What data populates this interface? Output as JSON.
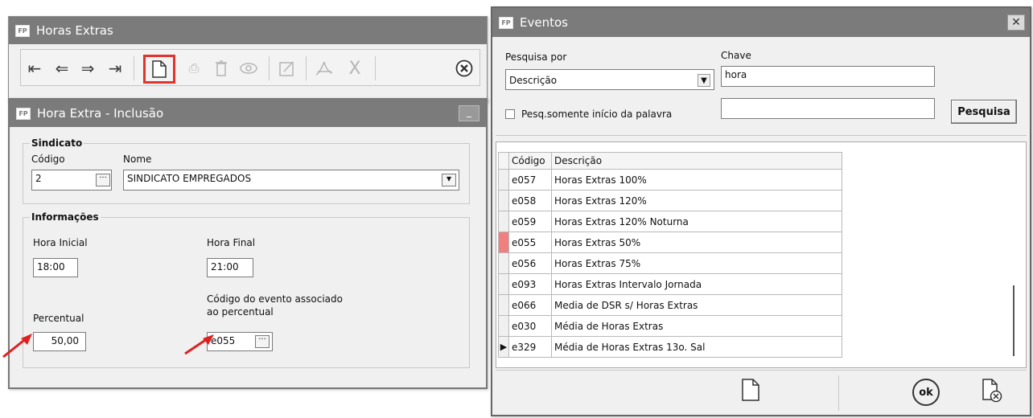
{
  "horas_extras": {
    "title": "Horas Extras",
    "toolbar": [
      "first-record",
      "previous-record",
      "next-record",
      "last-record",
      "new-document",
      "print",
      "delete",
      "view",
      "edit",
      "pdf",
      "excel",
      "close"
    ]
  },
  "inclusao": {
    "title": "Hora Extra - Inclusão",
    "sindicato": {
      "group_label": "Sindicato",
      "codigo_label": "Código",
      "codigo_value": "2",
      "nome_label": "Nome",
      "nome_value": "SINDICATO EMPREGADOS"
    },
    "informacoes": {
      "group_label": "Informações",
      "hora_inicial_label": "Hora Inicial",
      "hora_inicial_value": "18:00",
      "hora_final_label": "Hora Final",
      "hora_final_value": "21:00",
      "percentual_label": "Percentual",
      "percentual_value": "50,00",
      "codigo_evento_label_1": "Código do evento associado",
      "codigo_evento_label_2": "ao percentual",
      "codigo_evento_value": "e055"
    }
  },
  "eventos": {
    "title": "Eventos",
    "pesquisa_por_label": "Pesquisa por",
    "pesquisa_por_value": "Descrição",
    "chave_label": "Chave",
    "chave_value": "hora",
    "checkbox_label": "Pesq.somente início da palavra",
    "pesquisa_button": "Pesquisa",
    "columns": [
      "Código",
      "Descrição"
    ],
    "rows": [
      {
        "codigo": "e057",
        "descricao": "Horas Extras 100%"
      },
      {
        "codigo": "e058",
        "descricao": "Horas Extras 120%"
      },
      {
        "codigo": "e059",
        "descricao": "Horas Extras 120% Noturna"
      },
      {
        "codigo": "e055",
        "descricao": "Horas Extras 50%"
      },
      {
        "codigo": "e056",
        "descricao": "Horas Extras 75%"
      },
      {
        "codigo": "e093",
        "descricao": "Horas Extras Intervalo Jornada"
      },
      {
        "codigo": "e066",
        "descricao": "Media de DSR s/ Horas Extras"
      },
      {
        "codigo": "e030",
        "descricao": "Média de Horas Extras"
      },
      {
        "codigo": "e329",
        "descricao": "Média de Horas Extras 13o. Sal"
      }
    ],
    "ok_label": "ok"
  },
  "colors": {
    "titlebar": "#7b7b7b",
    "window_bg": "#f0f0f0",
    "highlight": "#e0342c",
    "arrow": "#e02020",
    "row_marker": "#f08080"
  }
}
